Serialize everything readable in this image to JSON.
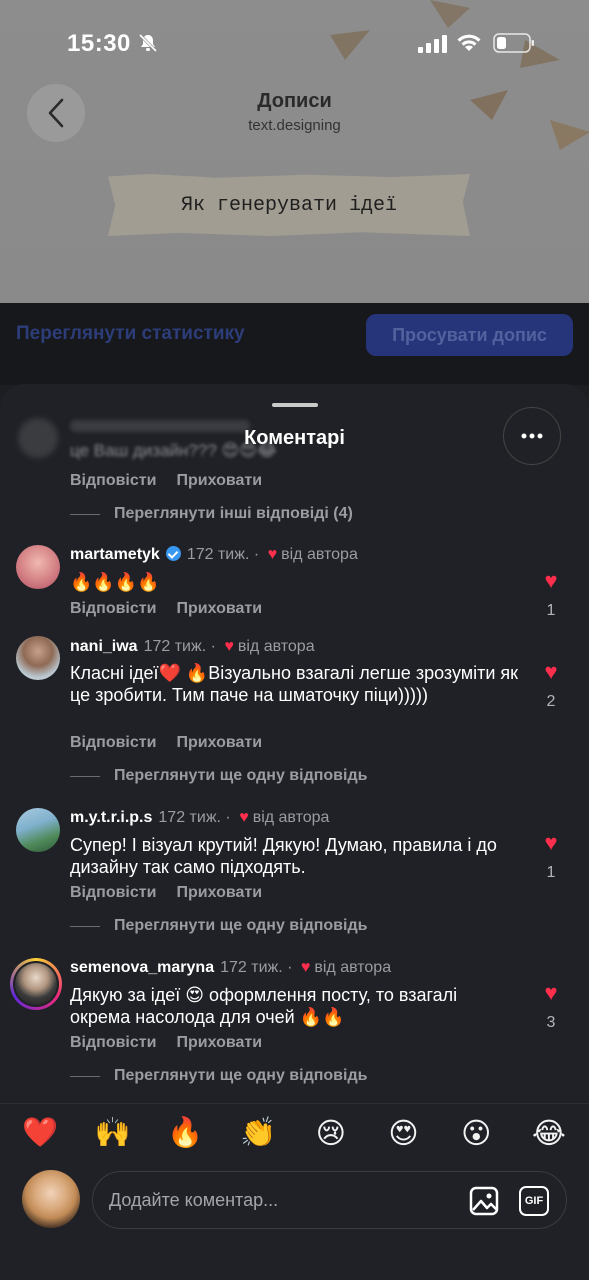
{
  "status": {
    "time": "15:30"
  },
  "header": {
    "title": "Дописи",
    "subtitle": "text.designing",
    "post_text": "Як генерувати ідеї"
  },
  "actions": {
    "stats": "Переглянути статистику",
    "promote": "Просувати допис"
  },
  "sheet": {
    "title": "Коментарі"
  },
  "blurred_comment": {
    "text": "це Ваш дизайн??? 😍😍😂",
    "reply": "Відповісти",
    "hide": "Приховати",
    "more_replies": "Переглянути інші відповіді (4)"
  },
  "comments": [
    {
      "user": "martametyk",
      "verified": true,
      "time": "172 тиж.",
      "by_author": "від автора",
      "text": "🔥🔥🔥🔥",
      "likes": "1",
      "reply": "Відповісти",
      "hide": "Приховати",
      "more_replies": ""
    },
    {
      "user": "nani_iwa",
      "verified": false,
      "time": "172 тиж.",
      "by_author": "від автора",
      "text": "Класні ідеї❤️ 🔥Візуально взагалі легше зрозуміти як це зробити. Тим паче на шматочку піци)))))",
      "likes": "2",
      "reply": "Відповісти",
      "hide": "Приховати",
      "more_replies": "Переглянути ще одну відповідь"
    },
    {
      "user": "m.y.t.r.i.p.s",
      "verified": false,
      "time": "172 тиж.",
      "by_author": "від автора",
      "text": "Супер! І візуал крутий! Дякую! Думаю, правила і до дизайну так само підходять.",
      "likes": "1",
      "reply": "Відповісти",
      "hide": "Приховати",
      "more_replies": "Переглянути ще одну відповідь"
    },
    {
      "user": "semenova_maryna",
      "verified": false,
      "time": "172 тиж.",
      "by_author": "від автора",
      "text": "Дякую за ідеї 😍 оформлення посту, то взагалі окрема насолода для очей 🔥🔥",
      "likes": "3",
      "reply": "Відповісти",
      "hide": "Приховати",
      "more_replies": "Переглянути ще одну відповідь"
    }
  ],
  "quick_emojis": [
    "❤️",
    "🙌",
    "🔥",
    "👏",
    "😢",
    "😍",
    "😮",
    "😂"
  ],
  "composer": {
    "placeholder": "Додайте коментар...",
    "gif": "GIF"
  },
  "colors": {
    "like": "#ff2e4c",
    "verified": "#3897f0",
    "promote_bg": "#263579"
  }
}
